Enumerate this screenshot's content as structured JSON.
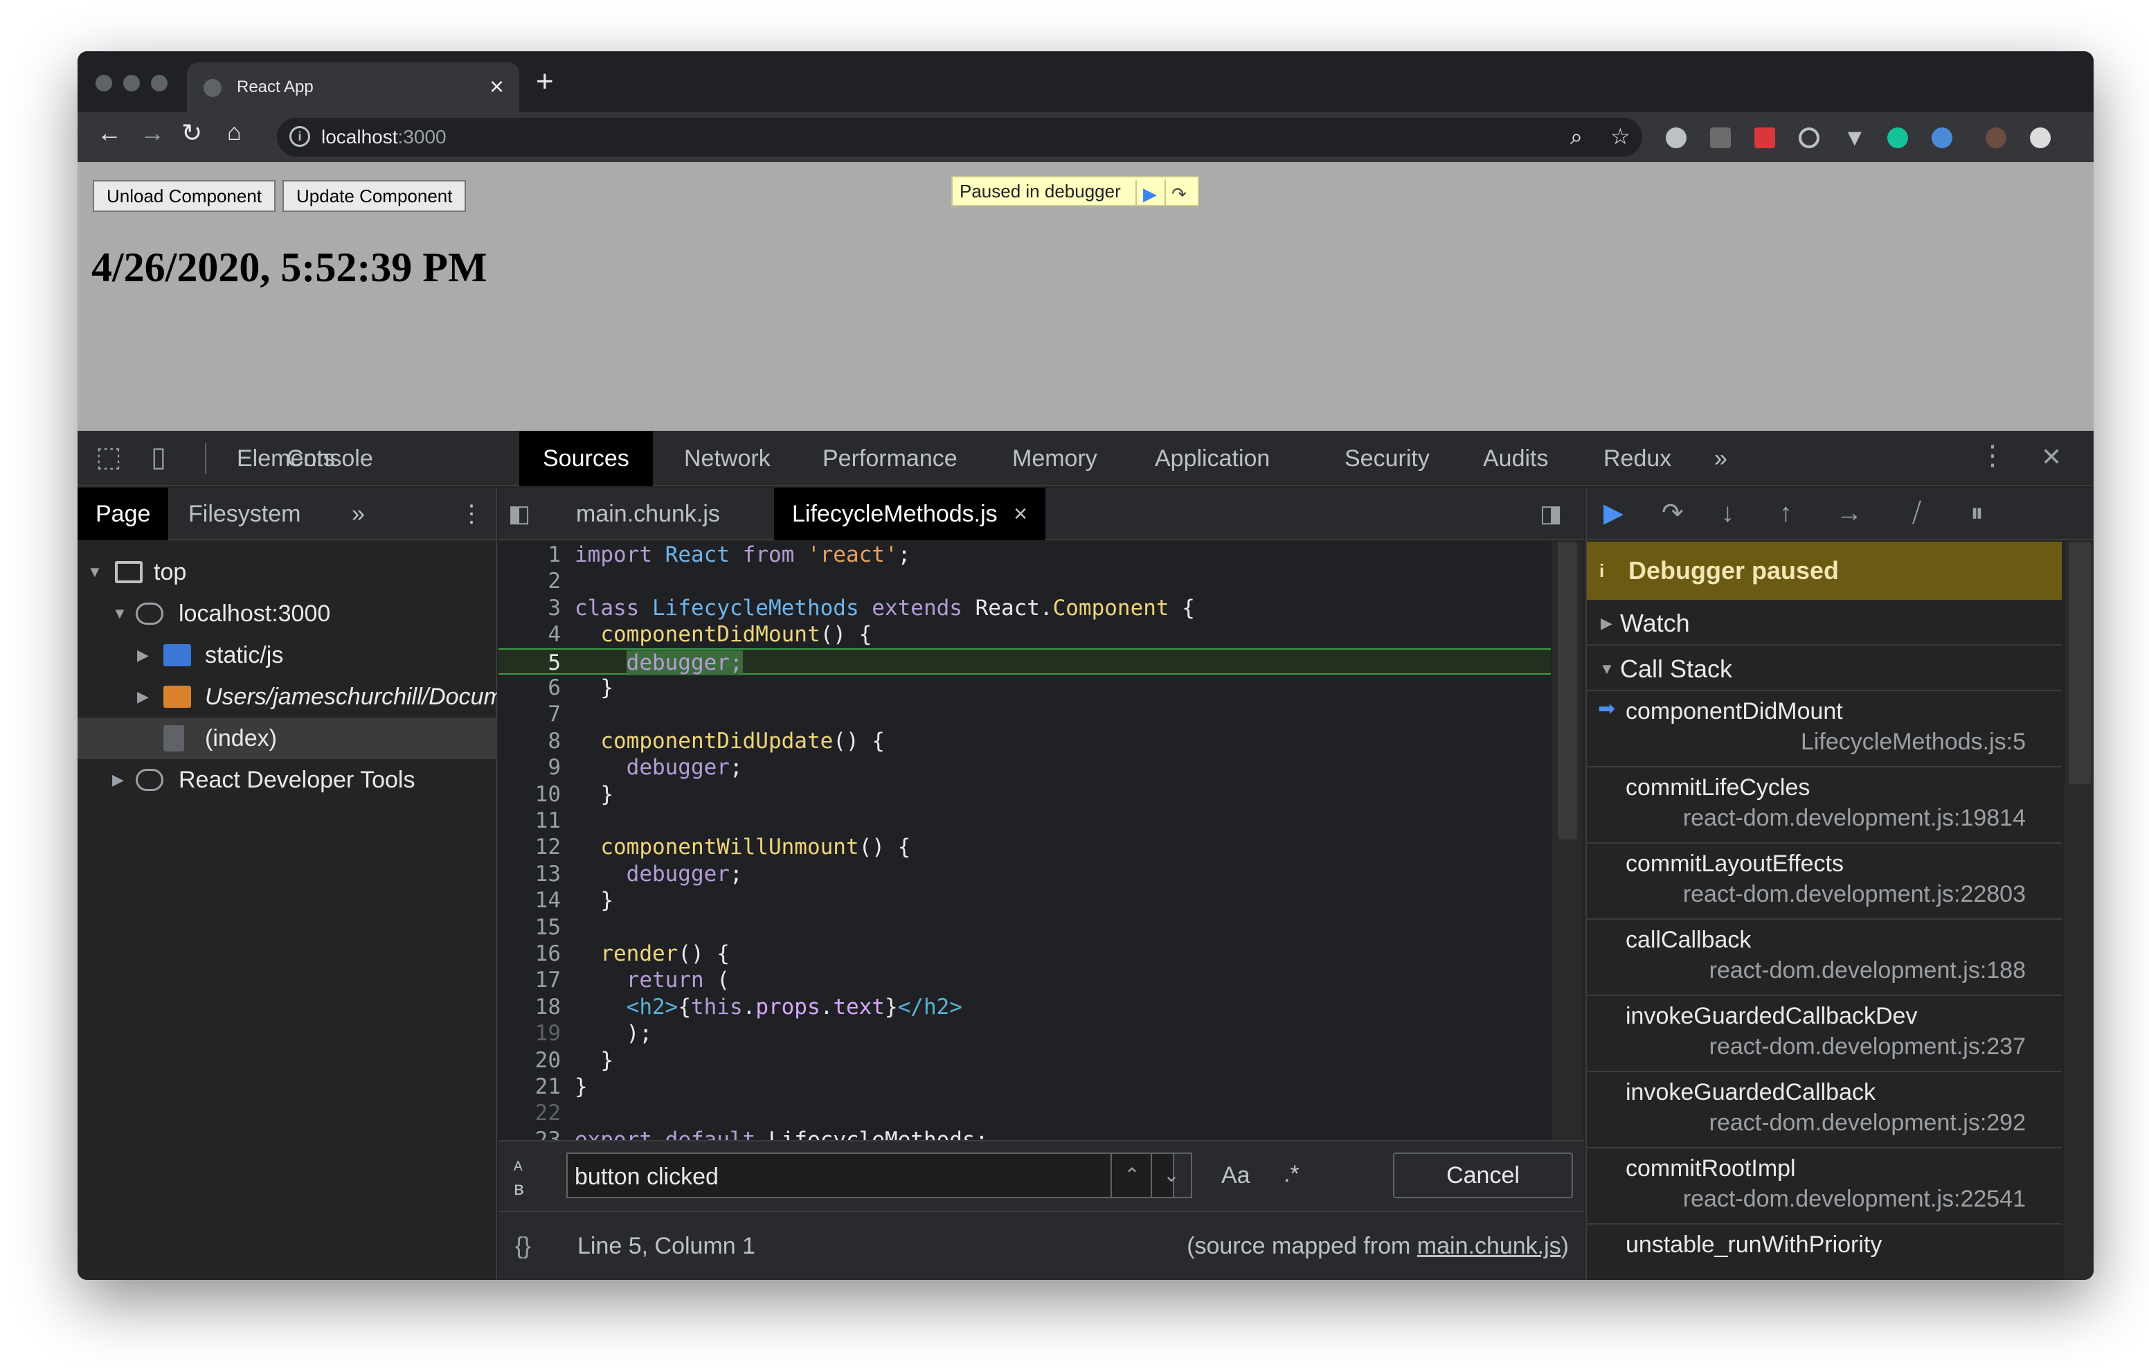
{
  "browser": {
    "tab_title": "React App",
    "tab_close": "×",
    "new_tab": "+",
    "url_host": "localhost",
    "url_port": ":3000"
  },
  "page": {
    "unload_button": "Unload Component",
    "update_button": "Update Component",
    "date_text": "4/26/2020, 5:52:39 PM",
    "paused_overlay": "Paused in debugger"
  },
  "devtools": {
    "tabs": [
      "Elements",
      "Console",
      "Sources",
      "Network",
      "Performance",
      "Memory",
      "Application",
      "Security",
      "Audits",
      "Redux"
    ],
    "active_tab": "Sources",
    "more": "»",
    "close": "✕"
  },
  "navigator": {
    "tabs": [
      "Page",
      "Filesystem"
    ],
    "more": "»",
    "tree": [
      {
        "label": "top"
      },
      {
        "label": "localhost:3000"
      },
      {
        "label": "static/js"
      },
      {
        "label": "Users/jameschurchill/Documents"
      },
      {
        "label": "(index)"
      },
      {
        "label": "React Developer Tools"
      }
    ]
  },
  "editor": {
    "tabs": [
      "main.chunk.js",
      "LifecycleMethods.js"
    ],
    "tab_close": "×",
    "search_value": "button clicked",
    "match_case": "Aa",
    "regex": ".*",
    "cancel": "Cancel",
    "pretty_print": "{}",
    "position": "Line 5, Column 1",
    "source_mapped_prefix": "(source mapped from ",
    "source_mapped_file": "main.chunk.js",
    "source_mapped_suffix": ")"
  },
  "debugger": {
    "paused_label": "Debugger paused",
    "paused_icon": "i",
    "watch": "Watch",
    "call_stack": "Call Stack",
    "frames": [
      {
        "name": "componentDidMount",
        "loc": "LifecycleMethods.js:5"
      },
      {
        "name": "commitLifeCycles",
        "loc": "react-dom.development.js:19814"
      },
      {
        "name": "commitLayoutEffects",
        "loc": "react-dom.development.js:22803"
      },
      {
        "name": "callCallback",
        "loc": "react-dom.development.js:188"
      },
      {
        "name": "invokeGuardedCallbackDev",
        "loc": "react-dom.development.js:237"
      },
      {
        "name": "invokeGuardedCallback",
        "loc": "react-dom.development.js:292"
      },
      {
        "name": "commitRootImpl",
        "loc": "react-dom.development.js:22541"
      },
      {
        "name": "unstable_runWithPriority",
        "loc": ""
      }
    ]
  },
  "icons": {
    "back": "back-arrow-icon",
    "forward": "forward-arrow-icon",
    "reload": "reload-icon",
    "home": "home-icon",
    "zoom": "zoom-icon",
    "star": "bookmark-star-icon",
    "inspect": "inspect-element-icon",
    "device": "device-toolbar-icon",
    "kebab": "kebab-menu-icon",
    "resume": "resume-icon",
    "step_over": "step-over-icon",
    "step_into": "step-into-icon",
    "step_out": "step-out-icon",
    "step": "step-icon",
    "deactivate": "deactivate-breakpoints-icon",
    "pause_exceptions": "pause-on-exceptions-icon"
  },
  "colors": {
    "paused_banner": "#6b5a12",
    "execution_line": "#3c9b4a",
    "active_frame_arrow": "#4a90f0"
  }
}
